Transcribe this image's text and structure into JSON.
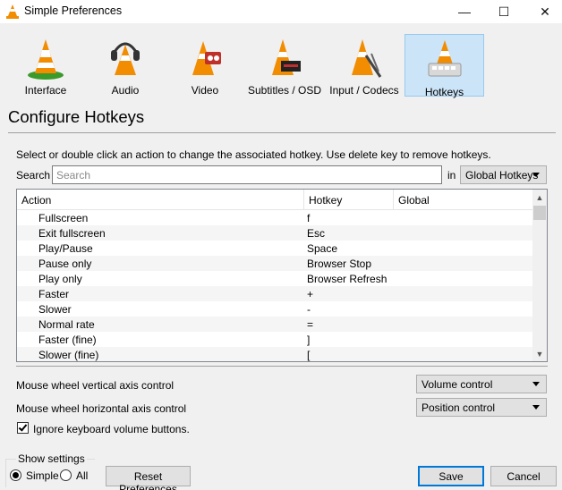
{
  "window": {
    "title": "Simple Preferences",
    "minimize_glyph": "—",
    "maximize_glyph": "☐",
    "close_glyph": "✕"
  },
  "categories": [
    {
      "label": "Interface",
      "icon": "interface-icon"
    },
    {
      "label": "Audio",
      "icon": "audio-icon"
    },
    {
      "label": "Video",
      "icon": "video-icon"
    },
    {
      "label": "Subtitles / OSD",
      "icon": "subtitles-icon"
    },
    {
      "label": "Input / Codecs",
      "icon": "input-codecs-icon"
    },
    {
      "label": "Hotkeys",
      "icon": "hotkeys-icon",
      "selected": true
    }
  ],
  "heading": "Configure Hotkeys",
  "instructions": "Select or double click an action to change the associated hotkey. Use delete key to remove hotkeys.",
  "search": {
    "label": "Search",
    "placeholder": "Search",
    "value": "",
    "in_label": "in",
    "scope": "Global Hotkeys"
  },
  "table": {
    "columns": [
      "Action",
      "Hotkey",
      "Global"
    ],
    "rows": [
      {
        "action": "Fullscreen",
        "hotkey": "f",
        "global": ""
      },
      {
        "action": "Exit fullscreen",
        "hotkey": "Esc",
        "global": ""
      },
      {
        "action": "Play/Pause",
        "hotkey": "Space",
        "global": ""
      },
      {
        "action": "Pause only",
        "hotkey": "Browser Stop",
        "global": ""
      },
      {
        "action": "Play only",
        "hotkey": "Browser Refresh",
        "global": ""
      },
      {
        "action": "Faster",
        "hotkey": "+",
        "global": ""
      },
      {
        "action": "Slower",
        "hotkey": "-",
        "global": ""
      },
      {
        "action": "Normal rate",
        "hotkey": "=",
        "global": ""
      },
      {
        "action": "Faster (fine)",
        "hotkey": "]",
        "global": ""
      },
      {
        "action": "Slower (fine)",
        "hotkey": "[",
        "global": ""
      }
    ],
    "scroll_up": "▲",
    "scroll_down": "▼"
  },
  "mouse_wheel": {
    "vertical_label": "Mouse wheel vertical axis control",
    "vertical_value": "Volume control",
    "horizontal_label": "Mouse wheel horizontal axis control",
    "horizontal_value": "Position control"
  },
  "ignore_volume": {
    "label": "Ignore keyboard volume buttons.",
    "checked": true
  },
  "show_settings": {
    "title": "Show settings",
    "simple_label": "Simple",
    "all_label": "All",
    "selected": "Simple"
  },
  "buttons": {
    "reset": "Reset Preferences",
    "save": "Save",
    "cancel": "Cancel"
  },
  "colors": {
    "cone_orange": "#f28c00",
    "selection": "#cce4f7",
    "default_button_border": "#0078d7"
  }
}
